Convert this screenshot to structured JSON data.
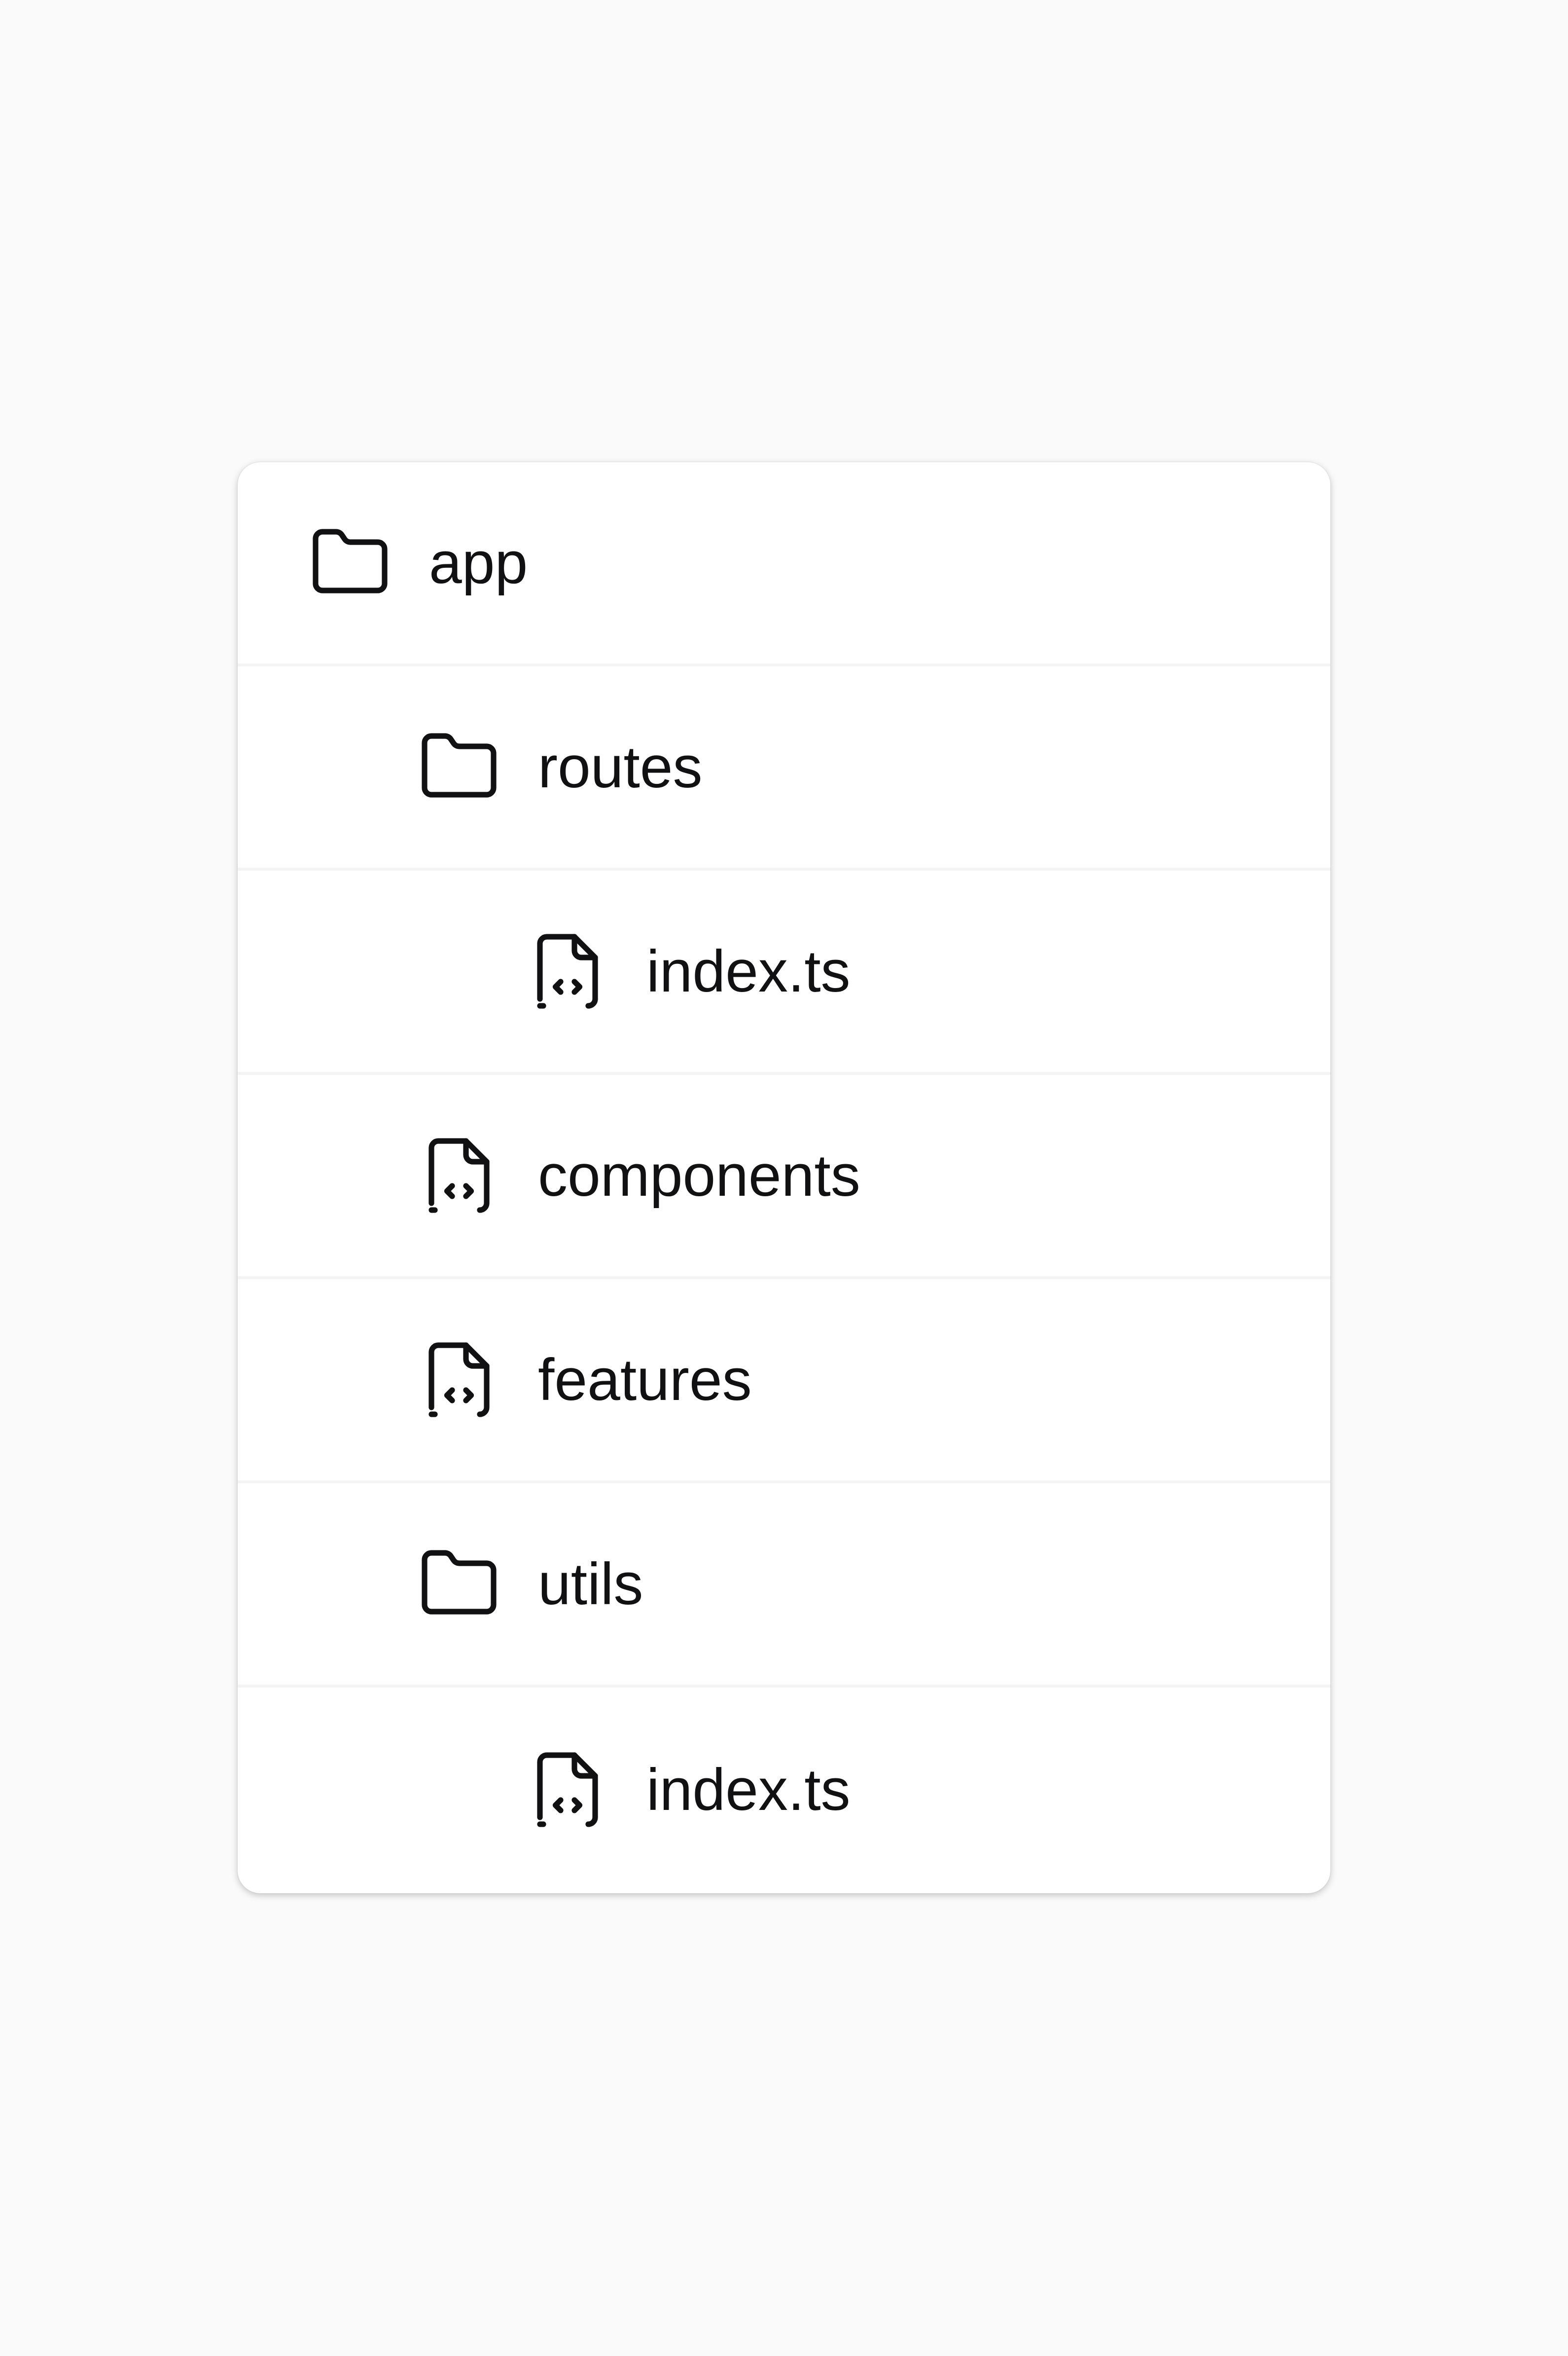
{
  "tree": {
    "items": [
      {
        "label": "app",
        "type": "folder",
        "depth": 0,
        "icon": "folder-icon"
      },
      {
        "label": "routes",
        "type": "folder",
        "depth": 1,
        "icon": "folder-icon"
      },
      {
        "label": "index.ts",
        "type": "file",
        "depth": 2,
        "icon": "file-code-icon"
      },
      {
        "label": "components",
        "type": "file",
        "depth": 1,
        "icon": "file-code-icon"
      },
      {
        "label": "features",
        "type": "file",
        "depth": 1,
        "icon": "file-code-icon"
      },
      {
        "label": "utils",
        "type": "folder",
        "depth": 1,
        "icon": "folder-icon"
      },
      {
        "label": "index.ts",
        "type": "file",
        "depth": 2,
        "icon": "file-code-icon"
      }
    ]
  },
  "colors": {
    "background": "#fafafa",
    "card": "#ffffff",
    "text": "#111113",
    "divider": "#f4f4f5"
  }
}
